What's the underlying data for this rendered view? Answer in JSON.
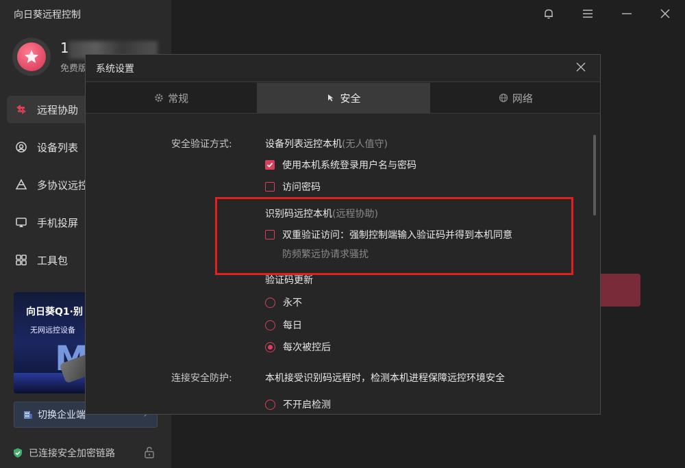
{
  "app": {
    "title": "向日葵远程控制"
  },
  "user": {
    "name": "1",
    "plan": "免费版"
  },
  "sidebar": {
    "items": [
      {
        "label": "远程协助",
        "icon": "remote-assist-icon"
      },
      {
        "label": "设备列表",
        "icon": "device-list-icon"
      },
      {
        "label": "多协议远控",
        "icon": "multi-protocol-icon"
      },
      {
        "label": "手机投屏",
        "icon": "screen-cast-icon"
      },
      {
        "label": "工具包",
        "icon": "toolbox-icon"
      }
    ],
    "promo": {
      "title": "向日葵Q1·别",
      "subtitle": "无网远控设备",
      "letter": "M"
    },
    "switch_label": "切换企业端",
    "status_text": "已连接安全加密链路"
  },
  "dialog": {
    "title": "系统设置",
    "tabs": [
      {
        "label": "常规",
        "icon": "gear-icon"
      },
      {
        "label": "安全",
        "icon": "security-cursor-icon"
      },
      {
        "label": "网络",
        "icon": "globe-icon"
      }
    ],
    "security": {
      "auth_label": "安全验证方式:",
      "device_list_title": "设备列表远控本机",
      "device_list_note": "(无人值守)",
      "use_system_login": {
        "label": "使用本机系统登录用户名与密码",
        "checked": true
      },
      "access_password": {
        "label": "访问密码",
        "checked": false
      },
      "code_title": "识别码远控本机",
      "code_note": "(远程协助)",
      "two_factor": {
        "label": "双重验证访问：强制控制端输入验证码并得到本机同意",
        "checked": false
      },
      "two_factor_hint": "防频繁远协请求骚扰",
      "code_update_title": "验证码更新",
      "code_update_options": [
        {
          "label": "永不",
          "selected": false
        },
        {
          "label": "每日",
          "selected": false
        },
        {
          "label": "每次被控后",
          "selected": true
        }
      ],
      "protection_label": "连接安全防护:",
      "protection_desc": "本机接受识别码远程时，检测本机进程保障远控环境安全",
      "protection_option": {
        "label": "不开启检测",
        "selected": false
      }
    }
  },
  "colors": {
    "accent": "#d8405c",
    "highlight": "#e32020"
  }
}
